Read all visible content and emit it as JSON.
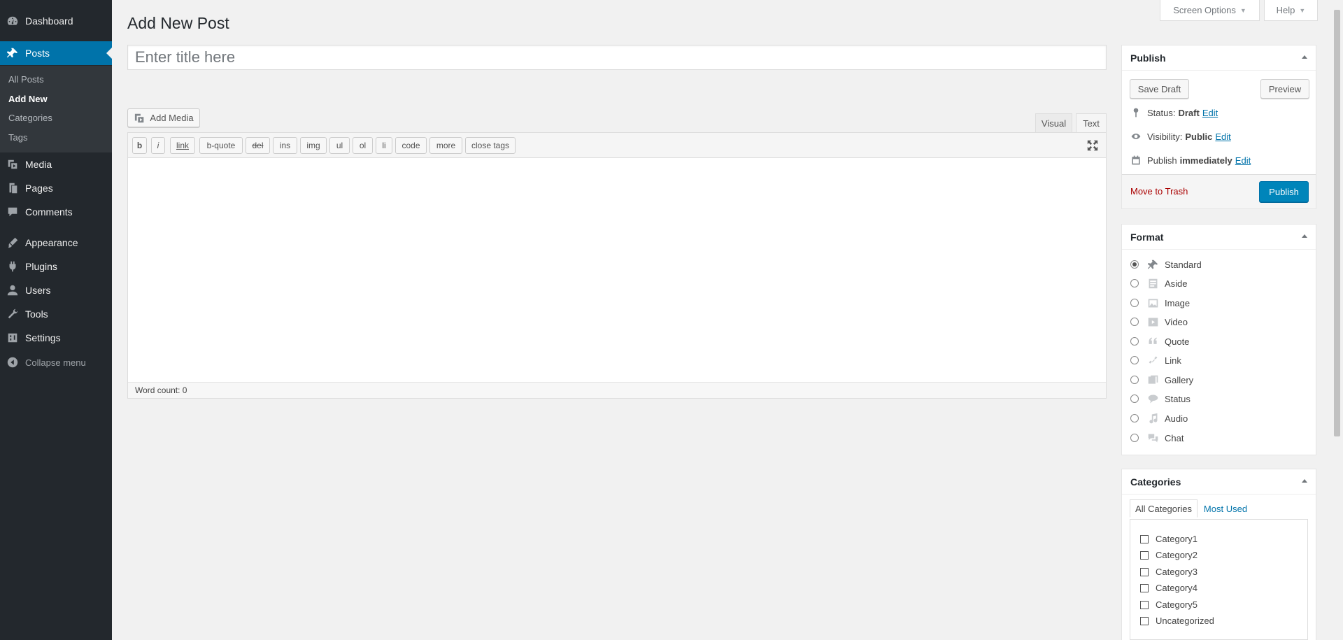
{
  "sidebar": {
    "menu": [
      {
        "label": "Dashboard",
        "icon": "dashboard-icon"
      },
      {
        "label": "Posts",
        "icon": "pin-icon"
      },
      {
        "label": "Media",
        "icon": "media-icon"
      },
      {
        "label": "Pages",
        "icon": "pages-icon"
      },
      {
        "label": "Comments",
        "icon": "comments-icon"
      },
      {
        "label": "Appearance",
        "icon": "appearance-icon"
      },
      {
        "label": "Plugins",
        "icon": "plugins-icon"
      },
      {
        "label": "Users",
        "icon": "users-icon"
      },
      {
        "label": "Tools",
        "icon": "tools-icon"
      },
      {
        "label": "Settings",
        "icon": "settings-icon"
      }
    ],
    "submenu": [
      "All Posts",
      "Add New",
      "Categories",
      "Tags"
    ],
    "collapse_label": "Collapse menu"
  },
  "top_buttons": {
    "screen_options": "Screen Options",
    "help": "Help"
  },
  "page_title": "Add New Post",
  "title_placeholder": "Enter title here",
  "add_media_label": "Add Media",
  "editor": {
    "tabs": {
      "visual": "Visual",
      "text": "Text"
    },
    "quicktags": [
      "b",
      "i",
      "link",
      "b-quote",
      "del",
      "ins",
      "img",
      "ul",
      "ol",
      "li",
      "code",
      "more",
      "close tags"
    ],
    "word_count": "Word count: 0"
  },
  "publish": {
    "title": "Publish",
    "save_draft": "Save Draft",
    "preview": "Preview",
    "status_label": "Status:",
    "status_value": "Draft",
    "visibility_label": "Visibility:",
    "visibility_value": "Public",
    "publish_label": "Publish",
    "publish_value": "immediately",
    "edit": "Edit",
    "move_to_trash": "Move to Trash",
    "publish_button": "Publish"
  },
  "format": {
    "title": "Format",
    "options": [
      "Standard",
      "Aside",
      "Image",
      "Video",
      "Quote",
      "Link",
      "Gallery",
      "Status",
      "Audio",
      "Chat"
    ],
    "selected": "Standard"
  },
  "categories": {
    "title": "Categories",
    "tab_all": "All Categories",
    "tab_used": "Most Used",
    "items": [
      "Category1",
      "Category2",
      "Category3",
      "Category4",
      "Category5",
      "Uncategorized"
    ]
  },
  "colors": {
    "sidebar_bg": "#23282d",
    "active": "#0073aa",
    "primary_button": "#0085ba",
    "trash": "#aa0000"
  }
}
